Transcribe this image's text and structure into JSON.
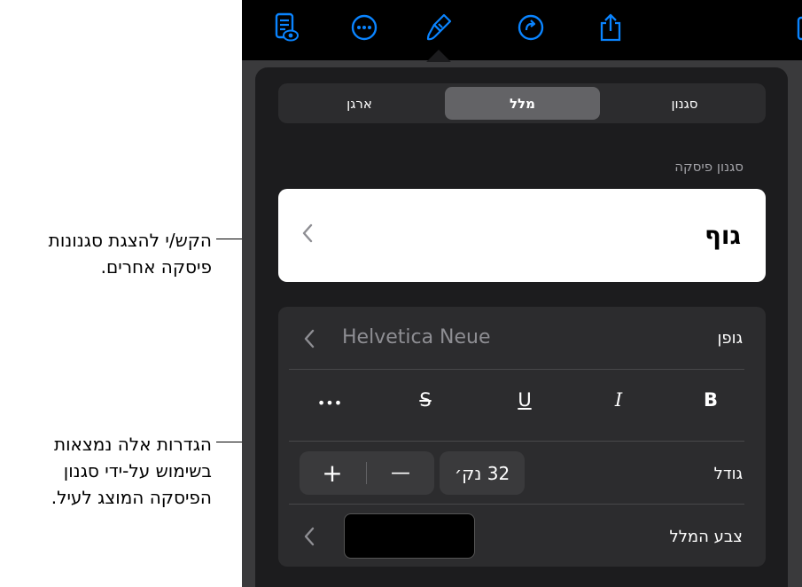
{
  "callouts": {
    "tap_styles": [
      "הקש/י להצגת סגנונות",
      "פיסקה אחרים."
    ],
    "settings_note": [
      "הגדרות אלה נמצאות",
      "בשימוש על-ידי סגנון",
      "הפיסקה המוצג לעיל."
    ]
  },
  "toolbar": {
    "icons": [
      "reading-view-icon",
      "more-icon",
      "format-brush-icon",
      "undo-icon",
      "share-icon",
      "document-icon"
    ],
    "accent_color": "#0a84ff"
  },
  "tabs": [
    {
      "label": "ארגן",
      "active": false
    },
    {
      "label": "מלל",
      "active": true
    },
    {
      "label": "סגנון",
      "active": false
    }
  ],
  "paragraph_style": {
    "section_label": "סגנון פיסקה",
    "value": "גוף"
  },
  "font": {
    "label": "גופן",
    "value": "Helvetica Neue"
  },
  "format_buttons": {
    "bold": "B",
    "italic": "I",
    "underline": "U",
    "strikethrough": "S",
    "more": "•••"
  },
  "size": {
    "label": "גודל",
    "value": "32 נק׳",
    "increase": "+",
    "decrease": "—"
  },
  "text_color": {
    "label": "צבע המלל",
    "color": "#000000"
  }
}
